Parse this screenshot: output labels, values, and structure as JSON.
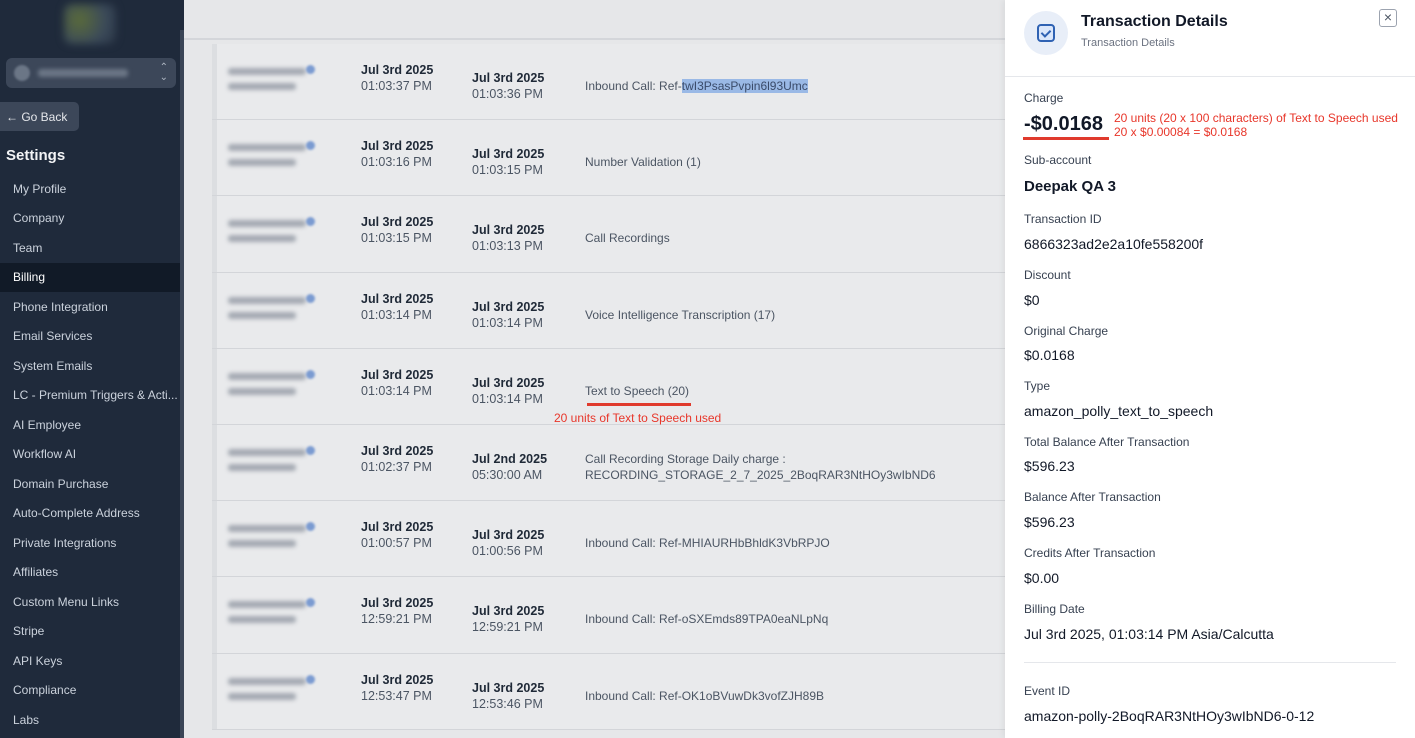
{
  "sidebar": {
    "go_back": "← Go Back",
    "settings_title": "Settings",
    "items": [
      {
        "label": "My Profile",
        "active": false
      },
      {
        "label": "Company",
        "active": false
      },
      {
        "label": "Team",
        "active": false
      },
      {
        "label": "Billing",
        "active": true
      },
      {
        "label": "Phone Integration",
        "active": false
      },
      {
        "label": "Email Services",
        "active": false
      },
      {
        "label": "System Emails",
        "active": false
      },
      {
        "label": "LC - Premium Triggers & Acti...",
        "active": false
      },
      {
        "label": "AI Employee",
        "active": false
      },
      {
        "label": "Workflow AI",
        "active": false
      },
      {
        "label": "Domain Purchase",
        "active": false
      },
      {
        "label": "Auto-Complete Address",
        "active": false
      },
      {
        "label": "Private Integrations",
        "active": false
      },
      {
        "label": "Affiliates",
        "active": false
      },
      {
        "label": "Custom Menu Links",
        "active": false
      },
      {
        "label": "Stripe",
        "active": false
      },
      {
        "label": "API Keys",
        "active": false
      },
      {
        "label": "Compliance",
        "active": false
      },
      {
        "label": "Labs",
        "active": false
      }
    ]
  },
  "table": {
    "rows": [
      {
        "date1": "Jul 3rd 2025",
        "time1": "01:03:37 PM",
        "date2": "Jul 3rd 2025",
        "time2": "01:03:36 PM",
        "desc_prefix": "Inbound Call: Ref-",
        "desc_highlight": "twI3PsasPvpin6l93Umc",
        "desc_line2": ""
      },
      {
        "date1": "Jul 3rd 2025",
        "time1": "01:03:16 PM",
        "date2": "Jul 3rd 2025",
        "time2": "01:03:15 PM",
        "desc_prefix": "Number Validation (1)",
        "desc_highlight": "",
        "desc_line2": ""
      },
      {
        "date1": "Jul 3rd 2025",
        "time1": "01:03:15 PM",
        "date2": "Jul 3rd 2025",
        "time2": "01:03:13 PM",
        "desc_prefix": "Call Recordings",
        "desc_highlight": "",
        "desc_line2": ""
      },
      {
        "date1": "Jul 3rd 2025",
        "time1": "01:03:14 PM",
        "date2": "Jul 3rd 2025",
        "time2": "01:03:14 PM",
        "desc_prefix": "Voice Intelligence Transcription (17)",
        "desc_highlight": "",
        "desc_line2": ""
      },
      {
        "date1": "Jul 3rd 2025",
        "time1": "01:03:14 PM",
        "date2": "Jul 3rd 2025",
        "time2": "01:03:14 PM",
        "desc_prefix": "Text to Speech (20)",
        "desc_highlight": "",
        "desc_line2": "",
        "annotation": "20 units of Text to Speech used"
      },
      {
        "date1": "Jul 3rd 2025",
        "time1": "01:02:37 PM",
        "date2": "Jul 2nd 2025",
        "time2": "05:30:00 AM",
        "desc_prefix": "Call Recording Storage Daily charge :",
        "desc_highlight": "",
        "desc_line2": "RECORDING_STORAGE_2_7_2025_2BoqRAR3NtHOy3wIbND6"
      },
      {
        "date1": "Jul 3rd 2025",
        "time1": "01:00:57 PM",
        "date2": "Jul 3rd 2025",
        "time2": "01:00:56 PM",
        "desc_prefix": "Inbound Call: Ref-MHIAURHbBhldK3VbRPJO",
        "desc_highlight": "",
        "desc_line2": ""
      },
      {
        "date1": "Jul 3rd 2025",
        "time1": "12:59:21 PM",
        "date2": "Jul 3rd 2025",
        "time2": "12:59:21 PM",
        "desc_prefix": "Inbound Call: Ref-oSXEmds89TPA0eaNLpNq",
        "desc_highlight": "",
        "desc_line2": ""
      },
      {
        "date1": "Jul 3rd 2025",
        "time1": "12:53:47 PM",
        "date2": "Jul 3rd 2025",
        "time2": "12:53:46 PM",
        "desc_prefix": "Inbound Call: Ref-OK1oBVuwDk3vofZJH89B",
        "desc_highlight": "",
        "desc_line2": ""
      }
    ]
  },
  "drawer": {
    "title": "Transaction Details",
    "subtitle": "Transaction Details",
    "close_icon": "×",
    "charge_label": "Charge",
    "charge_value": "-$0.0168",
    "charge_note_1": "20 units (20 x 100 characters) of Text to Speech used",
    "charge_note_2": "20 x $0.00084 = $0.0168",
    "fields": [
      {
        "label": "Sub-account",
        "value": "Deepak QA 3"
      },
      {
        "label": "Transaction ID",
        "value": "6866323ad2e2a10fe558200f"
      },
      {
        "label": "Discount",
        "value": "$0"
      },
      {
        "label": "Original Charge",
        "value": "$0.0168"
      },
      {
        "label": "Type",
        "value": "amazon_polly_text_to_speech"
      },
      {
        "label": "Total Balance After Transaction",
        "value": "$596.23"
      },
      {
        "label": "Balance After Transaction",
        "value": "$596.23"
      },
      {
        "label": "Credits After Transaction",
        "value": "$0.00"
      },
      {
        "label": "Billing Date",
        "value": "Jul 3rd 2025, 01:03:14 PM Asia/Calcutta"
      },
      {
        "label": "Event ID",
        "value": "amazon-polly-2BoqRAR3NtHOy3wIbND6-0-12"
      }
    ]
  },
  "colors": {
    "sidebar_bg": "#1f2a3b",
    "annotation_red": "#e8362a",
    "highlight": "#9ab9e6",
    "accent_blue": "#2f62b3"
  }
}
